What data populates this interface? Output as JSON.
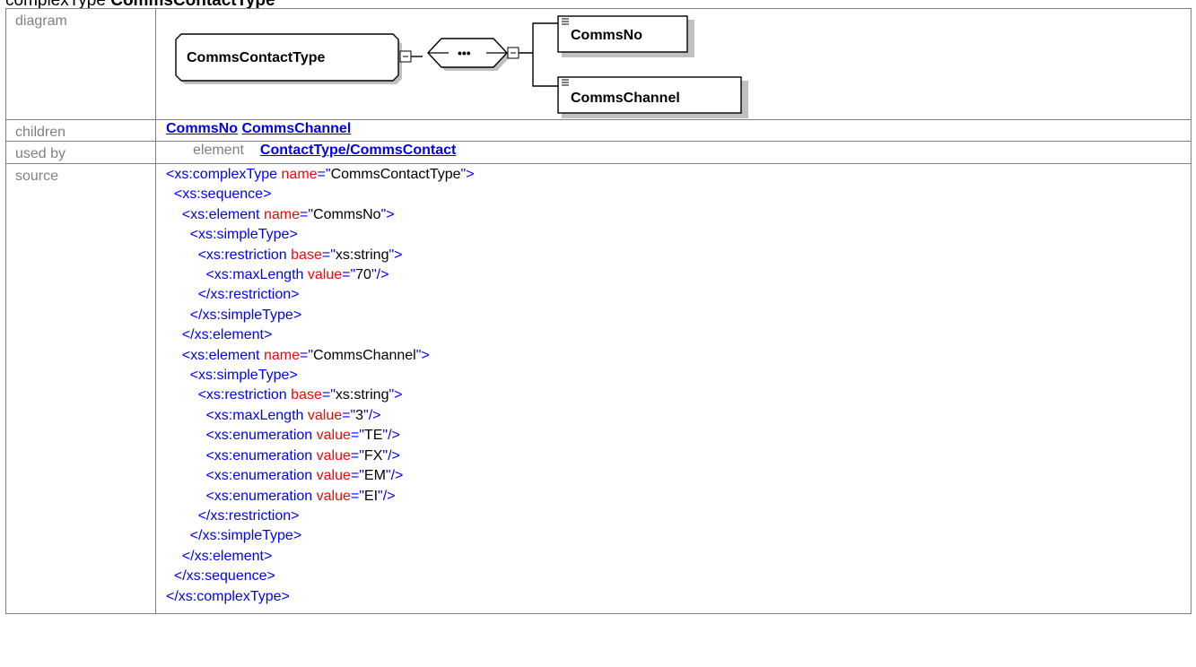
{
  "heading": {
    "prefix": "complexType",
    "name": "CommsContactType"
  },
  "labels": {
    "diagram": "diagram",
    "children": "children",
    "used_by": "used by",
    "source": "source"
  },
  "diagram": {
    "type_box": "CommsContactType",
    "sequence_symbol": "•••",
    "children": [
      "CommsNo",
      "CommsChannel"
    ]
  },
  "children_links": [
    "CommsNo",
    "CommsChannel"
  ],
  "used_by": {
    "kind": "element",
    "link": "ContactType/CommsContact"
  },
  "source_lines": [
    {
      "indent": "",
      "tag": "xs:complexType",
      "attr": "name",
      "value": "CommsContactType",
      "close": ">"
    },
    {
      "indent": " ",
      "tag": "xs:sequence",
      "close": ">"
    },
    {
      "indent": "  ",
      "tag": "xs:element",
      "attr": "name",
      "value": "CommsNo",
      "close": ">"
    },
    {
      "indent": "   ",
      "tag": "xs:simpleType",
      "close": ">"
    },
    {
      "indent": "    ",
      "tag": "xs:restriction",
      "attr": "base",
      "value": "xs:string",
      "close": ">"
    },
    {
      "indent": "     ",
      "tag": "xs:maxLength",
      "attr": "value",
      "value": "70",
      "close": "/>"
    },
    {
      "indent": "    ",
      "tag": "/xs:restriction",
      "close": ">"
    },
    {
      "indent": "   ",
      "tag": "/xs:simpleType",
      "close": ">"
    },
    {
      "indent": "  ",
      "tag": "/xs:element",
      "close": ">"
    },
    {
      "indent": "  ",
      "tag": "xs:element",
      "attr": "name",
      "value": "CommsChannel",
      "close": ">"
    },
    {
      "indent": "   ",
      "tag": "xs:simpleType",
      "close": ">"
    },
    {
      "indent": "    ",
      "tag": "xs:restriction",
      "attr": "base",
      "value": "xs:string",
      "close": ">"
    },
    {
      "indent": "     ",
      "tag": "xs:maxLength",
      "attr": "value",
      "value": "3",
      "close": "/>"
    },
    {
      "indent": "     ",
      "tag": "xs:enumeration",
      "attr": "value",
      "value": "TE",
      "close": "/>"
    },
    {
      "indent": "     ",
      "tag": "xs:enumeration",
      "attr": "value",
      "value": "FX",
      "close": "/>"
    },
    {
      "indent": "     ",
      "tag": "xs:enumeration",
      "attr": "value",
      "value": "EM",
      "close": "/>"
    },
    {
      "indent": "     ",
      "tag": "xs:enumeration",
      "attr": "value",
      "value": "EI",
      "close": "/>"
    },
    {
      "indent": "    ",
      "tag": "/xs:restriction",
      "close": ">"
    },
    {
      "indent": "   ",
      "tag": "/xs:simpleType",
      "close": ">"
    },
    {
      "indent": "  ",
      "tag": "/xs:element",
      "close": ">"
    },
    {
      "indent": " ",
      "tag": "/xs:sequence",
      "close": ">"
    },
    {
      "indent": "",
      "tag": "/xs:complexType",
      "close": ">"
    }
  ],
  "colors": {
    "tag": "#0000ff",
    "attr_name": "#ff0000",
    "attr_value": "#000000",
    "link": "#0000ee",
    "label": "#808080",
    "border": "#808080"
  }
}
